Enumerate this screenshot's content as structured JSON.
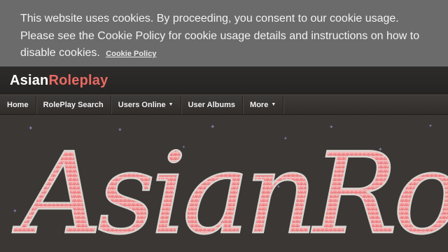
{
  "cookie_notice": {
    "message": "This website uses cookies. By proceeding, you consent to our cookie usage. Please see the Cookie Policy for cookie usage details and instructions on how to disable cookies.",
    "link_label": "Cookie Policy"
  },
  "site": {
    "logo_part1": "Asian",
    "logo_part2": "Roleplay"
  },
  "nav": {
    "items": [
      {
        "label": "Home"
      },
      {
        "label": "RolePlay Search"
      },
      {
        "label": "Users Online",
        "dropdown": "▼"
      },
      {
        "label": "User Albums"
      },
      {
        "label": "More",
        "dropdown": "▼"
      }
    ]
  },
  "banner": {
    "logo_text": "AsianRo"
  },
  "colors": {
    "accent": "#e86a64",
    "cookie_bg": "#6b6b6b",
    "page_bg": "#3b3836"
  }
}
